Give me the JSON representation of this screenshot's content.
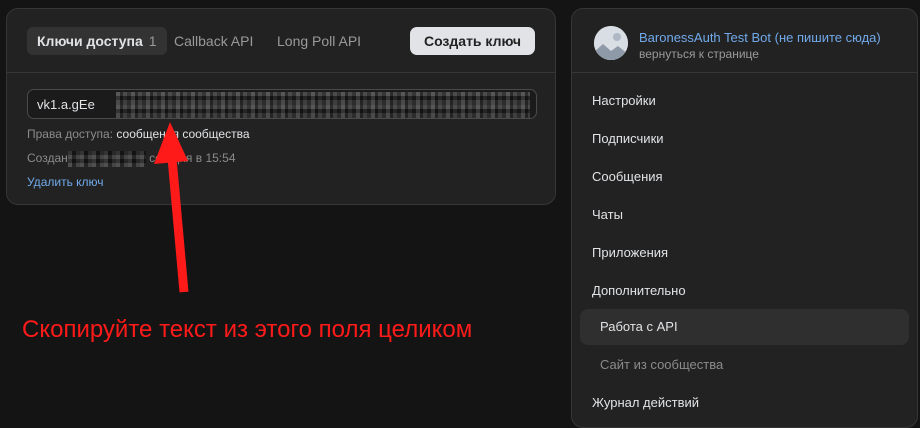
{
  "tabs": {
    "keys_label": "Ключи доступа",
    "keys_count": "1",
    "callback_label": "Callback API",
    "longpoll_label": "Long Poll API"
  },
  "create_button": "Создать ключ",
  "key": {
    "visible_prefix": "vk1.a.gEe",
    "access_label": "Права доступа:",
    "access_value": "сообщения сообщества",
    "created_label": "Создан",
    "created_suffix": "сегодня в 15:54",
    "delete_label": "Удалить ключ"
  },
  "annotation": {
    "text": "Скопируйте текст из этого поля целиком",
    "color": "#ff1a1a"
  },
  "sidebar": {
    "bot_name": "BaronessAuth Test Bot (не пишите сюда)",
    "back_label": "вернуться к странице",
    "items": [
      {
        "label": "Настройки"
      },
      {
        "label": "Подписчики"
      },
      {
        "label": "Сообщения"
      },
      {
        "label": "Чаты"
      },
      {
        "label": "Приложения"
      },
      {
        "label": "Дополнительно"
      },
      {
        "label": "Работа с API"
      },
      {
        "label": "Сайт из сообщества"
      },
      {
        "label": "Журнал действий"
      }
    ]
  },
  "colors": {
    "accent_link": "#71aaeb",
    "background": "#141414",
    "card": "#222222"
  }
}
